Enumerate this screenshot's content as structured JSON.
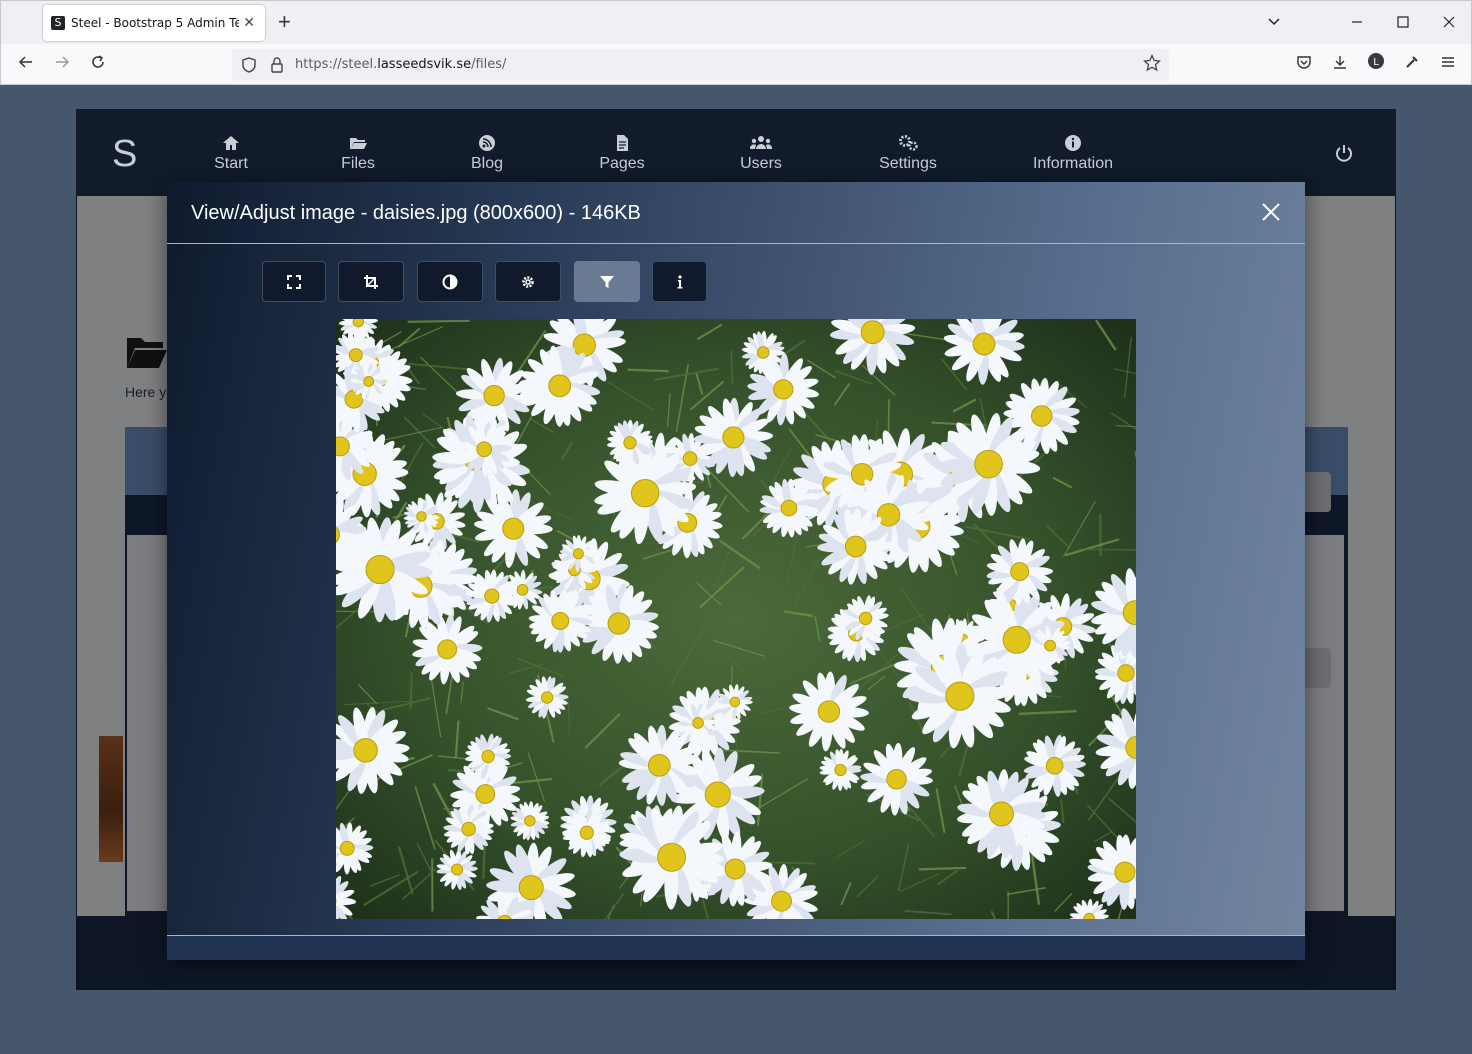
{
  "browser": {
    "tab_favicon": "S",
    "tab_title": "Steel - Bootstrap 5 Admin Template",
    "tab_close": "✕",
    "new_tab": "+",
    "url_prefix": "https://steel.",
    "url_domain": "lasseedsvik.se",
    "url_path": "/files/",
    "icons": [
      "back-icon",
      "forward-icon",
      "reload-icon",
      "shield-icon",
      "lock-icon",
      "bookmark-star-icon",
      "pocket-icon",
      "download-icon",
      "account-icon",
      "extension-icon",
      "menu-icon",
      "tab-list-icon",
      "minimize-icon",
      "maximize-icon",
      "close-window-icon"
    ]
  },
  "app": {
    "brand": "S",
    "menu": [
      {
        "label": "Start",
        "icon": "home-icon"
      },
      {
        "label": "Files",
        "icon": "folder-open-icon"
      },
      {
        "label": "Blog",
        "icon": "rss-icon"
      },
      {
        "label": "Pages",
        "icon": "file-icon"
      },
      {
        "label": "Users",
        "icon": "users-icon"
      },
      {
        "label": "Settings",
        "icon": "cogs-icon"
      },
      {
        "label": "Information",
        "icon": "info-icon"
      }
    ],
    "page_intro": "Here y"
  },
  "modal": {
    "title": "View/Adjust image - daisies.jpg (800x600) - 146KB",
    "toolbar": [
      {
        "name": "fullscreen-button",
        "icon": "expand-icon",
        "active": false
      },
      {
        "name": "crop-button",
        "icon": "crop-icon",
        "active": false
      },
      {
        "name": "contrast-button",
        "icon": "contrast-icon",
        "active": false
      },
      {
        "name": "settings-button",
        "icon": "gear-icon",
        "active": false
      },
      {
        "name": "filter-button",
        "icon": "filter-icon",
        "active": true
      },
      {
        "name": "info-button",
        "icon": "info-i-icon",
        "active": false
      }
    ],
    "image": {
      "subject": "daisies"
    }
  },
  "colors": {
    "header_bg": "#111b2b",
    "modal_dark": "#0f1a2d",
    "modal_light": "#72869f",
    "active_button": "#6a7a92"
  }
}
